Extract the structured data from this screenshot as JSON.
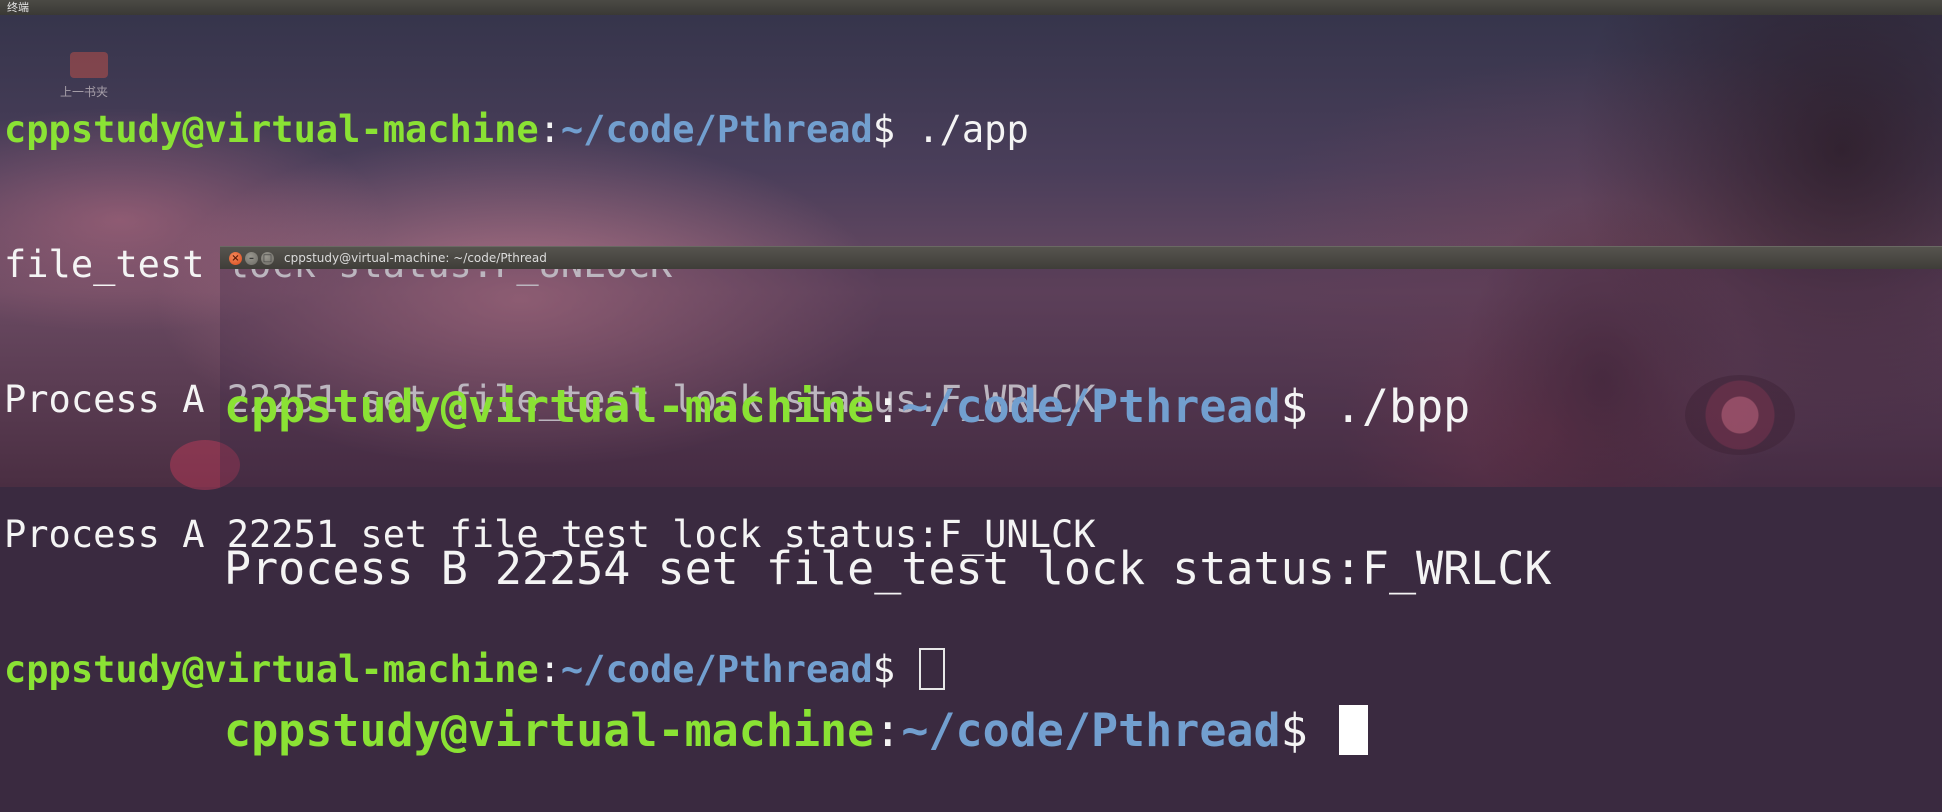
{
  "top_panel": {
    "title": "终端"
  },
  "desktop": {
    "icon_label": "上一书夹"
  },
  "terminal1": {
    "lines": [
      {
        "user": "cppstudy@virtual-machine",
        "sep": ":",
        "path": "~/code/Pthread",
        "prompt": "$ ",
        "cmd": "./app"
      },
      {
        "text": "file_test lock status:F_UNLOCK"
      },
      {
        "text": "Process A 22251 set file_test lock status:F_WRLCK"
      },
      {
        "text": "Process A 22251 set file_test lock status:F_UNLCK"
      },
      {
        "user": "cppstudy@virtual-machine",
        "sep": ":",
        "path": "~/code/Pthread",
        "prompt": "$ "
      }
    ]
  },
  "terminal2": {
    "window_title": "cppstudy@virtual-machine: ~/code/Pthread",
    "buttons": {
      "close": "×",
      "minimize": "–",
      "maximize": "□"
    },
    "lines": [
      {
        "user": "cppstudy@virtual-machine",
        "sep": ":",
        "path": "~/code/Pthread",
        "prompt": "$ ",
        "cmd": "./bpp"
      },
      {
        "text": "Process B 22254 set file_test lock status:F_WRLCK"
      },
      {
        "user": "cppstudy@virtual-machine",
        "sep": ":",
        "path": "~/code/Pthread",
        "prompt": "$ "
      }
    ]
  },
  "colors": {
    "user": "#8ae234",
    "path": "#729fcf",
    "text": "#f4f4f4",
    "close_button": "#e05a2a"
  }
}
